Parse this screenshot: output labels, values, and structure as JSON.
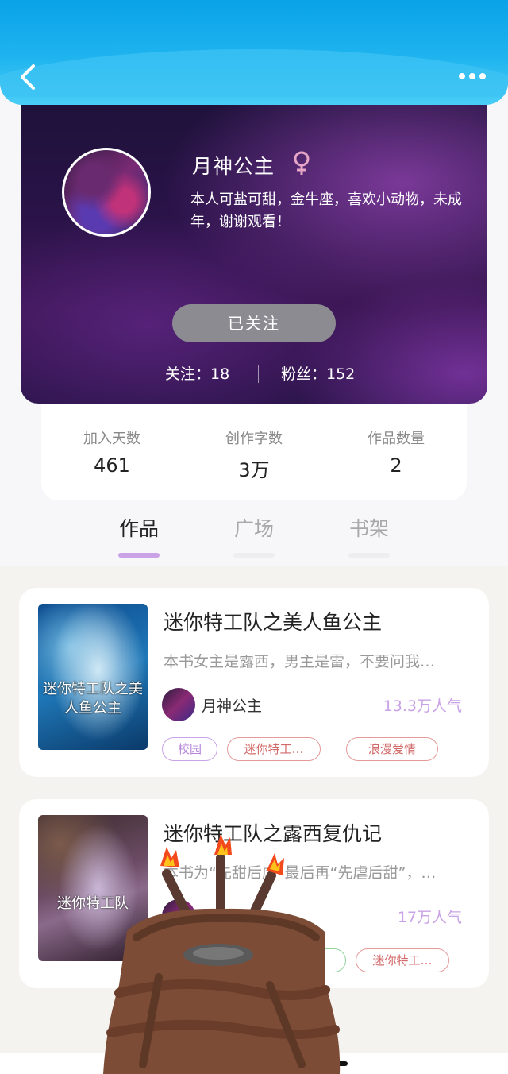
{
  "colors": {
    "accent": "#c9a3e6",
    "header": "#0aa2e8",
    "follow_button": "#8c8b92",
    "tag_red": "#d26a6a"
  },
  "nav": {
    "back_icon": "chevron-left-icon",
    "more_icon": "more-icon"
  },
  "profile": {
    "name": "月神公主",
    "gender_icon": "female-icon",
    "bio": "本人可盐可甜，金牛座，喜欢小动物，未成年，谢谢观看！",
    "follow_button": "已关注",
    "following_label": "关注：18",
    "fans_label": "粉丝：152"
  },
  "stats": [
    {
      "label": "加入天数",
      "value": "461"
    },
    {
      "label": "创作字数",
      "value": "3万"
    },
    {
      "label": "作品数量",
      "value": "2"
    }
  ],
  "tabs": [
    {
      "label": "作品",
      "active": true
    },
    {
      "label": "广场",
      "active": false
    },
    {
      "label": "书架",
      "active": false
    }
  ],
  "books": [
    {
      "title": "迷你特工队之美人鱼公主",
      "desc": "本书女主是露西，男主是雷，不要问我…",
      "author": "月神公主",
      "popularity": "13.3万人气",
      "cover_text": "迷你特工队之美人鱼公主",
      "tags": [
        "校园",
        "迷你特工…",
        "浪漫爱情"
      ]
    },
    {
      "title": "迷你特工队之露西复仇记",
      "desc": "本书为“先甜后虐”最后再“先虐后甜”，…",
      "author": "",
      "popularity": "17万人气",
      "cover_text": "迷你特工队",
      "tags": [
        "迷你特工…"
      ]
    }
  ]
}
